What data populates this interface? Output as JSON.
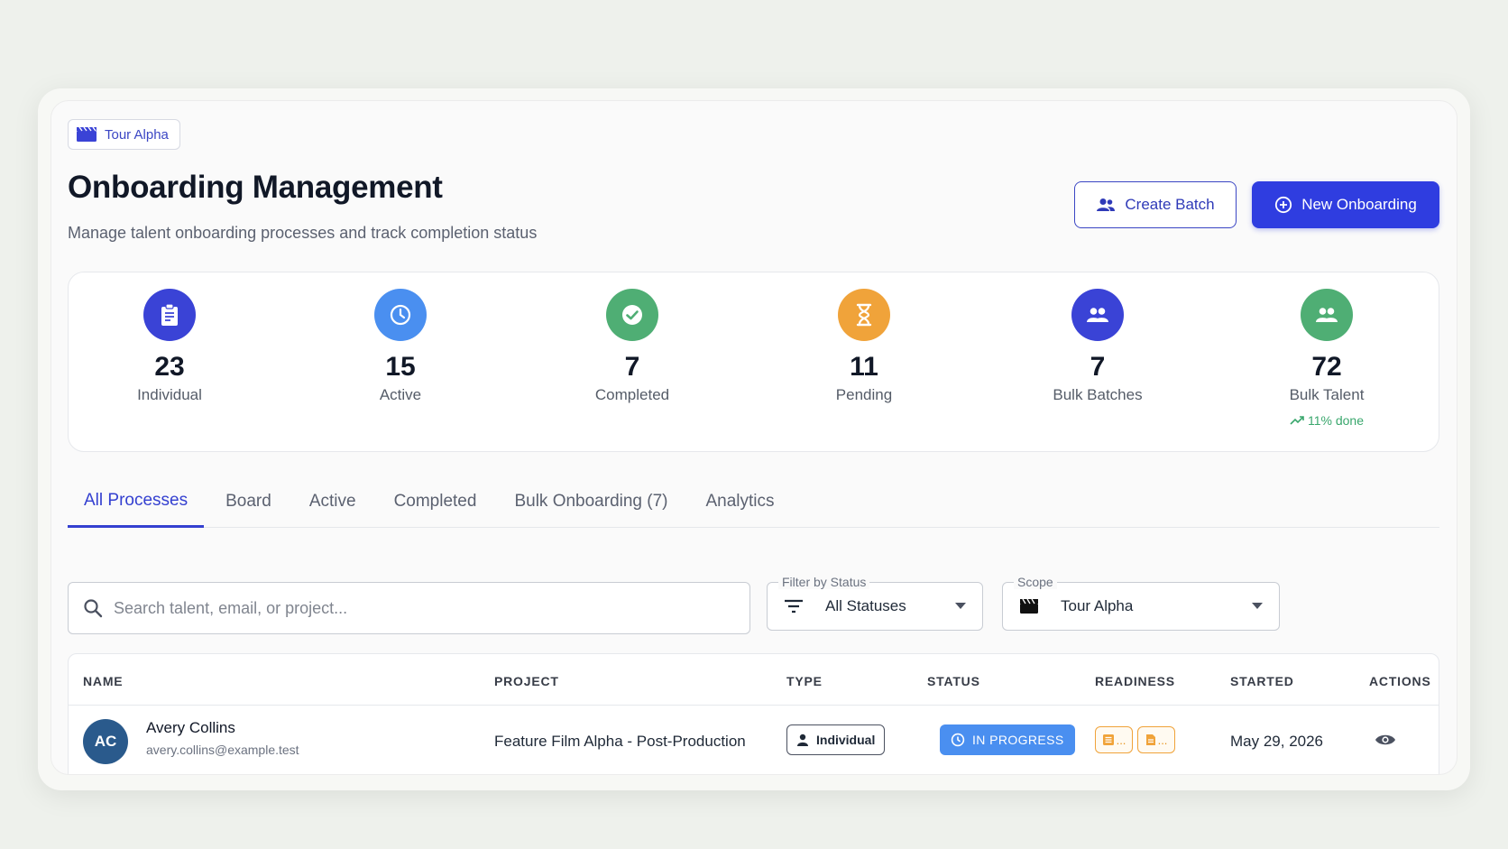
{
  "project_chip": {
    "label": "Tour Alpha",
    "icon": "clapperboard-icon"
  },
  "header": {
    "title": "Onboarding Management",
    "subtitle": "Manage talent onboarding processes and track completion status",
    "create_batch_label": "Create Batch",
    "new_onboarding_label": "New Onboarding"
  },
  "stats": [
    {
      "value": "23",
      "label": "Individual",
      "icon": "clipboard-icon",
      "color": "#3a43d6"
    },
    {
      "value": "15",
      "label": "Active",
      "icon": "clock-icon",
      "color": "#4a8ff0"
    },
    {
      "value": "7",
      "label": "Completed",
      "icon": "check-circle-icon",
      "color": "#4fae74"
    },
    {
      "value": "11",
      "label": "Pending",
      "icon": "hourglass-icon",
      "color": "#f0a33a"
    },
    {
      "value": "7",
      "label": "Bulk Batches",
      "icon": "group-icon",
      "color": "#3a43d6"
    },
    {
      "value": "72",
      "label": "Bulk Talent",
      "icon": "group-icon",
      "color": "#4fae74",
      "trend": "11% done"
    }
  ],
  "tabs": [
    {
      "label": "All Processes",
      "active": true
    },
    {
      "label": "Board"
    },
    {
      "label": "Active"
    },
    {
      "label": "Completed"
    },
    {
      "label": "Bulk Onboarding (7)"
    },
    {
      "label": "Analytics"
    }
  ],
  "filters": {
    "search_placeholder": "Search talent, email, or project...",
    "status_label": "Filter by Status",
    "status_value": "All Statuses",
    "scope_label": "Scope",
    "scope_value": "Tour Alpha"
  },
  "table": {
    "columns": [
      "NAME",
      "PROJECT",
      "TYPE",
      "STATUS",
      "READINESS",
      "STARTED",
      "ACTIONS"
    ],
    "rows": [
      {
        "initials": "AC",
        "name": "Avery Collins",
        "email": "avery.collins@example.test",
        "project": "Feature Film Alpha - Post-Production",
        "type": "Individual",
        "status": "IN PROGRESS",
        "readiness": [
          "...",
          "..."
        ],
        "started": "May 29, 2026"
      }
    ]
  },
  "colors": {
    "accent": "#2f3de0",
    "status_in_progress": "#4a8ff0",
    "readiness": "#f0a33a"
  }
}
